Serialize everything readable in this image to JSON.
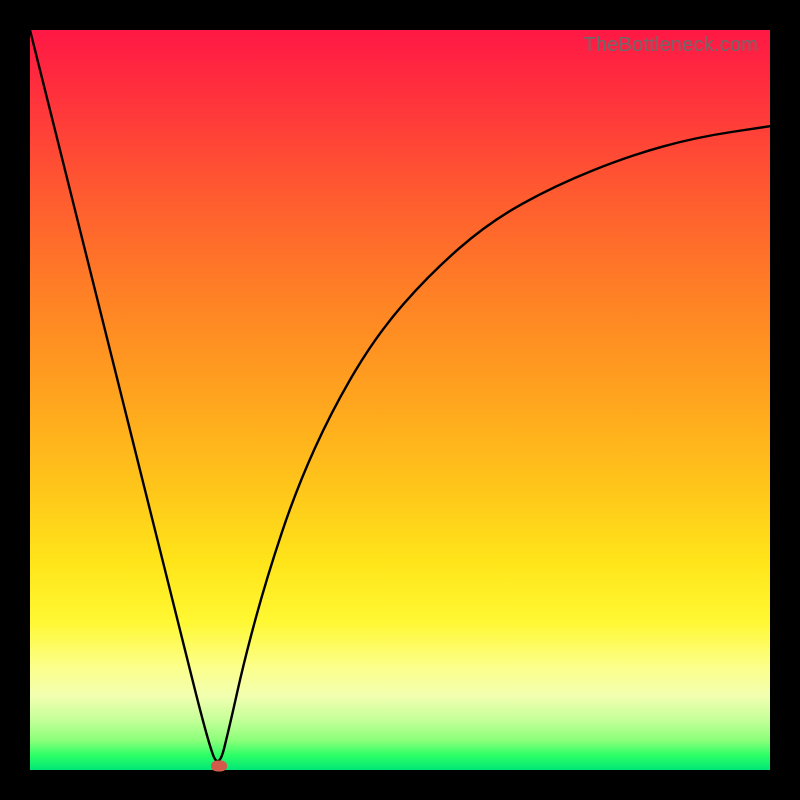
{
  "watermark": "TheBottleneck.com",
  "colors": {
    "frame": "#000000",
    "curve": "#000000",
    "marker": "#d15a4a",
    "gradient_top": "#ff1845",
    "gradient_bottom": "#00e676"
  },
  "chart_data": {
    "type": "line",
    "title": "",
    "xlabel": "",
    "ylabel": "",
    "xlim": [
      0,
      100
    ],
    "ylim": [
      0,
      100
    ],
    "grid": false,
    "legend": false,
    "series": [
      {
        "name": "left-branch",
        "x": [
          0,
          5,
          10,
          15,
          20,
          24,
          25.5
        ],
        "values": [
          100,
          80,
          60,
          40,
          20,
          4,
          0
        ]
      },
      {
        "name": "right-branch",
        "x": [
          25.5,
          27,
          29,
          32,
          36,
          41,
          47,
          54,
          62,
          71,
          81,
          90,
          100
        ],
        "values": [
          0,
          6,
          15,
          26,
          38,
          49,
          59,
          67,
          74,
          79,
          83,
          85.5,
          87
        ]
      }
    ],
    "marker": {
      "x": 25.5,
      "y": 0.5
    },
    "annotations": []
  }
}
